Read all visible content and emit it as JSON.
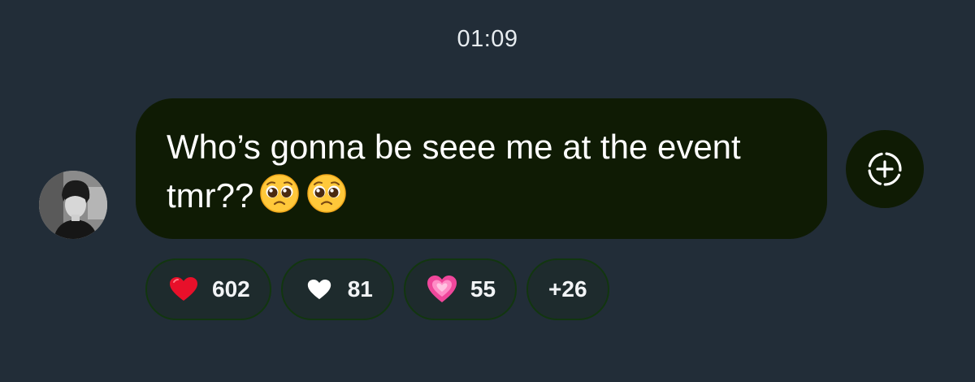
{
  "message": {
    "timestamp": "01:09",
    "text": "Who’s gonna be seee me at the event tmr??",
    "emojis": [
      "pleading-face",
      "pleading-face"
    ]
  },
  "sender": {
    "avatar_icon": "profile-photo"
  },
  "add_reaction": {
    "icon": "add-reaction-icon"
  },
  "reactions": [
    {
      "emoji": "red-heart",
      "count": "602"
    },
    {
      "emoji": "white-heart",
      "count": "81"
    },
    {
      "emoji": "growing-pink-heart",
      "count": "55"
    }
  ],
  "more_reactions": "+26",
  "colors": {
    "background": "#222d38",
    "bubble": "#0f1b04",
    "pill_border": "#12360f",
    "text": "#ffffff"
  }
}
